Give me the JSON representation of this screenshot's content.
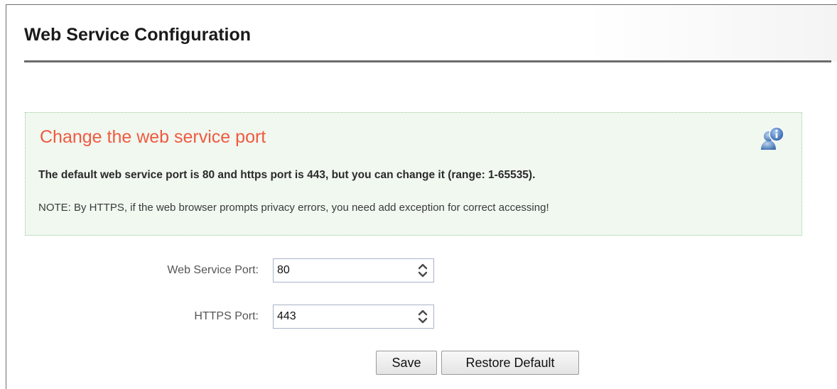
{
  "header": {
    "title": "Web Service Configuration"
  },
  "info": {
    "heading": "Change the web service port",
    "description": "The default web service port is 80 and https port is 443, but you can change it (range: 1-65535).",
    "note": "NOTE: By HTTPS, if the web browser prompts privacy errors, you need add exception for correct accessing!",
    "icon": "user-info-icon"
  },
  "form": {
    "web_port_label": "Web Service Port:",
    "web_port_value": "80",
    "https_port_label": "HTTPS Port:",
    "https_port_value": "443"
  },
  "buttons": {
    "save_label": "Save",
    "restore_label": "Restore Default"
  },
  "colors": {
    "heading_accent": "#f05a40",
    "info_background": "#f0f8f0",
    "info_border": "#9ccc9c"
  }
}
